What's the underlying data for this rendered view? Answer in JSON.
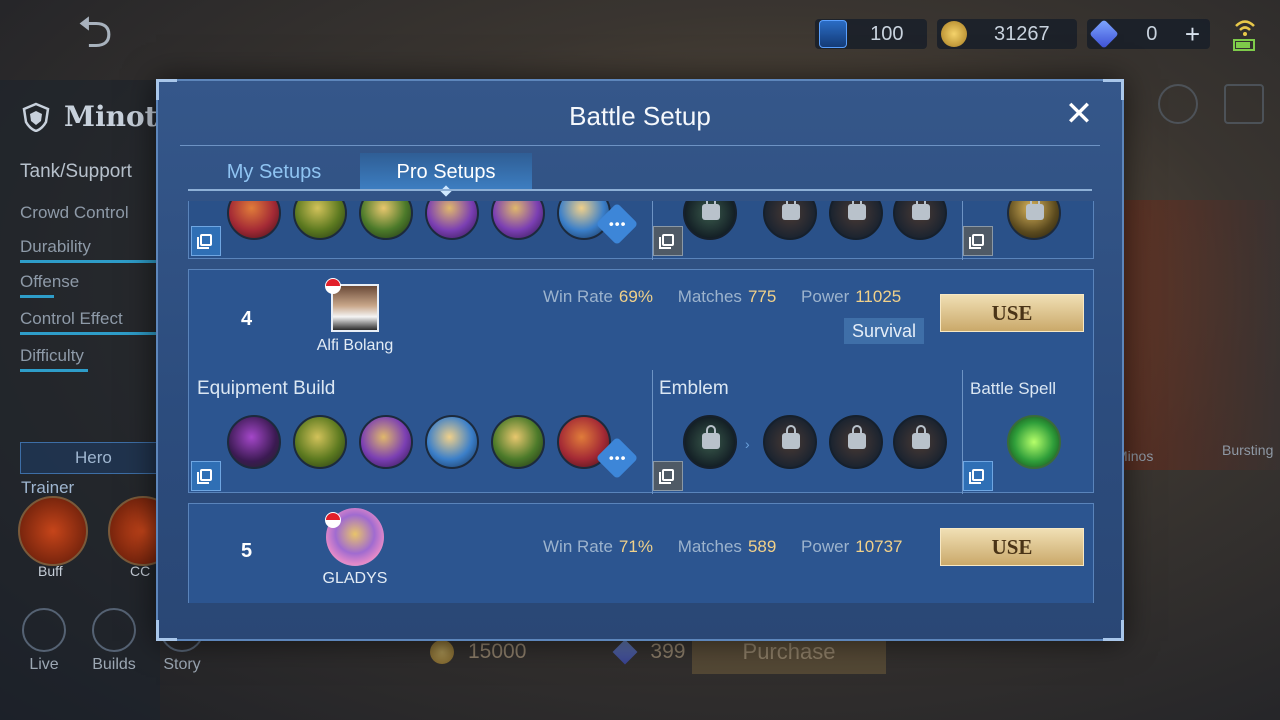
{
  "top_bar": {
    "tickets": "100",
    "coins": "31267",
    "diamonds": "0",
    "plus_label": "+"
  },
  "hero": {
    "name": "Minotaur",
    "role": "Tank/Support",
    "stats": [
      "Crowd Control",
      "Durability",
      "Offense",
      "Control Effect",
      "Difficulty"
    ],
    "stat_levels": [
      1.0,
      0.8,
      0.2,
      0.85,
      0.45
    ],
    "trainer_label": "Hero Trainer",
    "tabs": [
      "Buff",
      "CC"
    ],
    "nav": [
      "Live",
      "Builds",
      "Story"
    ]
  },
  "purchase": {
    "coin_price": "15000",
    "diamond_price": "399",
    "button": "Purchase"
  },
  "background_labels": [
    "Bursting",
    "Minos"
  ],
  "modal": {
    "title": "Battle Setup",
    "close_label": "✕",
    "tabs": [
      "My Setups",
      "Pro Setups"
    ],
    "active_tab": "Pro Setups",
    "setups": [
      {
        "rank": "4",
        "player": "Alfi Bolang",
        "win_rate_label": "Win Rate",
        "win_rate": "69%",
        "matches_label": "Matches",
        "matches": "775",
        "power_label": "Power",
        "power": "11025",
        "tag": "Survival",
        "use_label": "USE",
        "equipment_label": "Equipment Build",
        "emblem_label": "Emblem",
        "spell_label": "Battle Spell",
        "items": [
          "boots-icon",
          "green-blade-icon",
          "purple-shield-icon",
          "blue-armor-icon",
          "green-helm-icon",
          "red-guard-icon"
        ],
        "emblems": [
          "emblem-core-icon",
          "emblem-heart-icon",
          "emblem-hourglass-icon",
          "emblem-spiral-icon"
        ],
        "spell": "vengeance-spell-icon"
      },
      {
        "rank": "5",
        "player": "GLADYS",
        "win_rate_label": "Win Rate",
        "win_rate": "71%",
        "matches_label": "Matches",
        "matches": "589",
        "power_label": "Power",
        "power": "10737",
        "use_label": "USE"
      }
    ]
  },
  "colors": {
    "modal_bg": "#2c4c7d",
    "accent_gold": "#f1d18a",
    "use_button": "#caa96a",
    "tab_active": "#3d7fc3"
  }
}
